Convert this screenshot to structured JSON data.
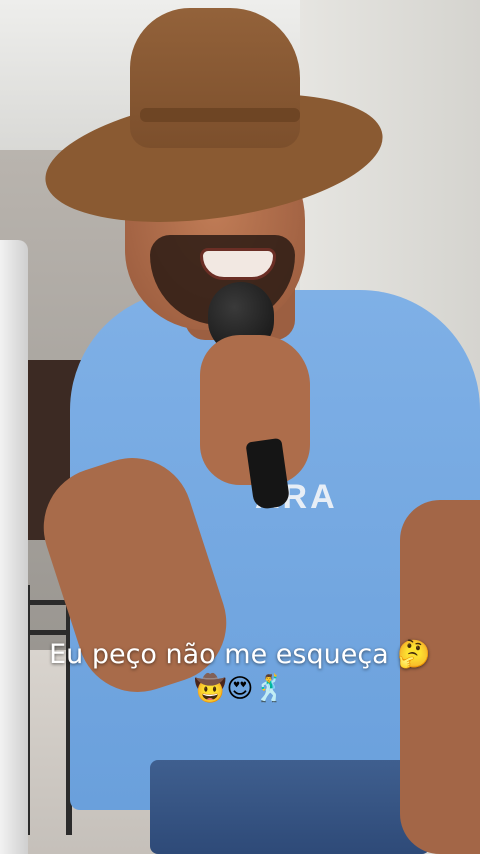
{
  "video": {
    "shirt_text": "ARA"
  },
  "caption": {
    "line1": "Eu peço não me esqueça 🤔",
    "line2": "🤠😍🕺"
  },
  "icons": {
    "thinking_face": "thinking-face-icon",
    "cowboy_face": "cowboy-face-icon",
    "heart_eyes": "heart-eyes-icon",
    "dancer": "dancer-icon"
  },
  "colors": {
    "caption_text": "#ffffff",
    "shirt": "#7fb0e6",
    "hat": "#8a5a32"
  }
}
